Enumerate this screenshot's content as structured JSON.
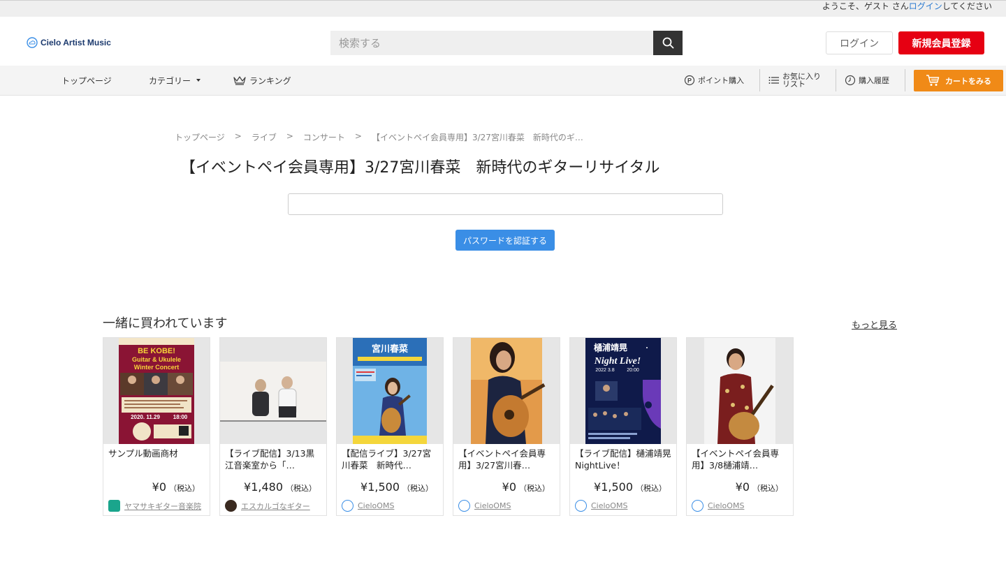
{
  "topbar": {
    "greeting": "ようこそ、ゲスト さん",
    "login_link": "ログイン",
    "suffix": "してください"
  },
  "header": {
    "logo_text": "Cielo Artist Music",
    "search_placeholder": "検索する",
    "login_label": "ログイン",
    "register_label": "新規会員登録"
  },
  "nav": {
    "items": [
      "トップページ",
      "カテゴリー",
      "ランキング"
    ],
    "points": "ポイント購入",
    "favorites": "お気に入り\nリスト",
    "favorites_line1": "お気に入り",
    "favorites_line2": "リスト",
    "history": "購入履歴",
    "cart": "カートをみる"
  },
  "breadcrumb": [
    "トップページ",
    "ライブ",
    "コンサート",
    "【イベントペイ会員専用】3/27宮川春菜　新時代のギ…"
  ],
  "breadcrumb_sep": ">",
  "page_title": "【イベントペイ会員専用】3/27宮川春菜　新時代のギターリサイタル",
  "password_button": "パスワードを認証する",
  "related": {
    "title": "一緒に買われています",
    "more_label": "もっと見る",
    "tax_label": "（税込）",
    "products": [
      {
        "name": "サンプル動画商材",
        "price": "¥0",
        "shop": "ヤマサキギター音楽院"
      },
      {
        "name": "【ライブ配信】3/13黒江音楽室から「…",
        "price": "¥1,480",
        "shop": "エスカルゴなギター"
      },
      {
        "name": "【配信ライブ】3/27宮川春菜　新時代…",
        "price": "¥1,500",
        "shop": "CieloOMS"
      },
      {
        "name": "【イベントペイ会員専用】3/27宮川春…",
        "price": "¥0",
        "shop": "CieloOMS"
      },
      {
        "name": "【ライブ配信】樋浦靖晃NightLive！",
        "price": "¥1,500",
        "shop": "CieloOMS"
      },
      {
        "name": "【イベントペイ会員専用】3/8樋浦靖…",
        "price": "¥0",
        "shop": "CieloOMS"
      }
    ],
    "thumb_texts": {
      "p1_line1": "BE KOBE!",
      "p1_line2": "Guitar & Ukulele",
      "p1_line3": "Winter Concert",
      "p1_date": "2020. 11.29",
      "p1_time": "18:00",
      "p3_title": "宮川春菜",
      "p5_title": "樋浦靖晃",
      "p5_sub": "Night Live!",
      "p5_date": "2022 3.8",
      "p5_time": "20:00"
    }
  },
  "colors": {
    "accent_red": "#e60012",
    "cart_orange": "#f08a17",
    "button_blue": "#3a8ee6",
    "link_blue": "#2a7ad0"
  }
}
